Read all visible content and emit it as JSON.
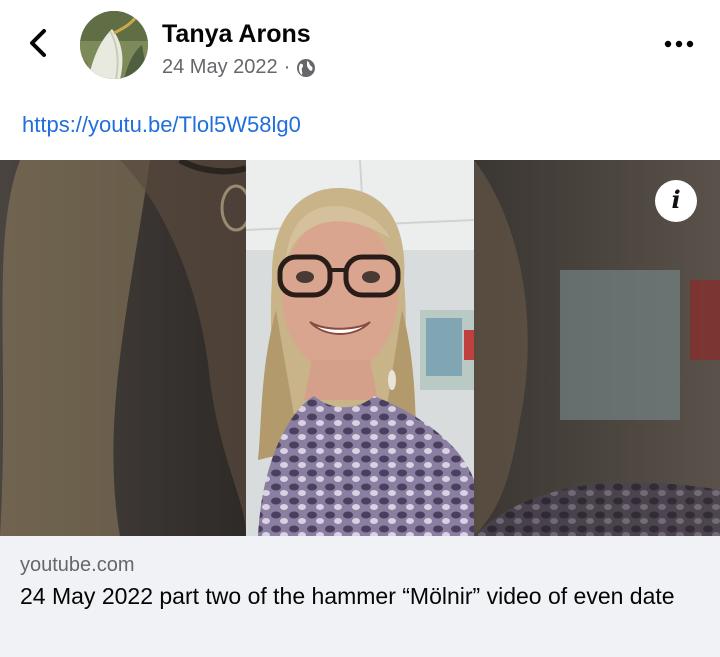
{
  "post": {
    "author_name": "Tanya Arons",
    "date": "24 May 2022",
    "separator": "·",
    "link_text": "https://youtu.be/Tlol5W58lg0"
  },
  "icons": {
    "back": "chevron-left-icon",
    "more": "more-horizontal-icon",
    "privacy": "globe-icon",
    "info": "info-icon"
  },
  "link_card": {
    "domain": "youtube.com",
    "title": "24 May 2022 part two of the hammer “Mölnir” video of even date",
    "info_glyph": "i"
  },
  "colors": {
    "link": "#216fdb",
    "caption_bg": "#f0f2f5",
    "secondary_text": "#65676b"
  }
}
